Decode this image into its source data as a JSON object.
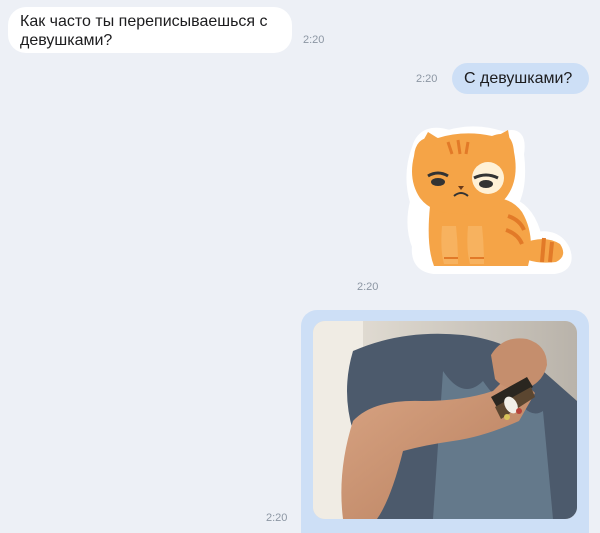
{
  "messages": [
    {
      "direction": "incoming",
      "type": "text",
      "text": "Как часто ты переписываешься с девушками?",
      "time": "2:20"
    },
    {
      "direction": "outgoing",
      "type": "text",
      "text": "С девушками?",
      "time": "2:20"
    },
    {
      "direction": "outgoing",
      "type": "sticker",
      "sticker": "sad-orange-cat-sticker",
      "time": "2:20"
    },
    {
      "direction": "outgoing",
      "type": "photo",
      "photo": "flexed-arm-photo",
      "time": "2:20"
    }
  ],
  "colors": {
    "background": "#edf0f6",
    "incoming_bubble": "#ffffff",
    "outgoing_bubble": "#cddff6",
    "timestamp": "#8c96a3",
    "sticker_cat": "#f5a447"
  }
}
